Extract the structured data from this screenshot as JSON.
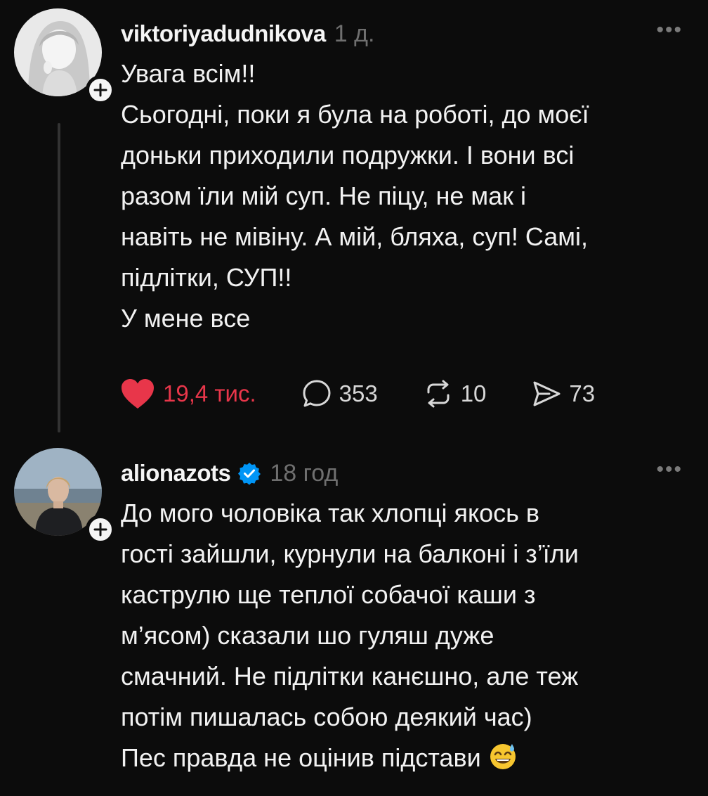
{
  "posts": [
    {
      "username": "viktoriyadudnikova",
      "time": "1 д.",
      "more_icon": "more-horizontal-icon",
      "lines": [
        "Увага всім!!",
        "Сьогодні, поки я була на роботі, до моєї",
        "доньки приходили подружки. І вони всі",
        "разом їли мій суп. Не піцу, не мак і",
        "навіть не мівіну. А мій, бляха, суп! Самі,",
        "підлітки, СУП!!",
        "У мене все"
      ],
      "likes": "19,4 тис.",
      "comments": "353",
      "reposts": "10",
      "shares": "73",
      "liked": true
    },
    {
      "username": "alionazots",
      "verified": true,
      "time": "18 год",
      "lines": [
        "До мого чоловіка так хлопці якось в",
        "гості зайшли, курнули на балконі і з’їли",
        "каструлю ще теплої собачої каши з",
        "м’ясом) сказали шо гуляш дуже",
        "смачний. Не підлітки канєшно, але теж",
        "потім пишалась собою деякий час)",
        "Пес правда не оцінив підстави"
      ],
      "trailing_emoji": "grinning-sweat-emoji"
    }
  ],
  "colors": {
    "background": "#0c0c0c",
    "like": "#e8364a",
    "muted": "#6f6f6f",
    "verified": "#0095f6"
  }
}
